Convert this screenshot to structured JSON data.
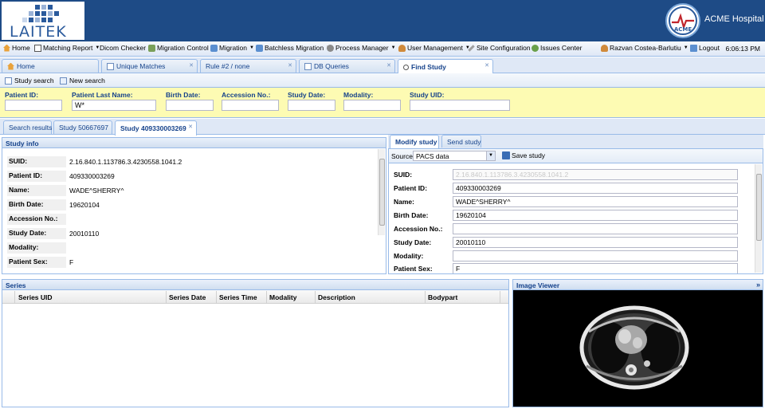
{
  "brand": {
    "logo_text": "LAITEK",
    "hospital_name": "ACME Hospital",
    "hospital_logo_text": "ACME"
  },
  "menu": {
    "items": [
      "Home",
      "Matching Report",
      "Dicom Checker",
      "Migration Control",
      "Migration",
      "Batchless Migration",
      "Process Manager",
      "User Management",
      "Site Configuration",
      "Issues Center"
    ],
    "user": "Razvan Costea-Barlutiu",
    "logout": "Logout",
    "clock": "6:06:13 PM"
  },
  "tabs": [
    "Home",
    "Unique Matches",
    "Rule #2 / none",
    "DB Queries",
    "Find Study"
  ],
  "toolbar": {
    "study_search": "Study search",
    "new_search": "New search"
  },
  "search": {
    "labels": [
      "Patient ID:",
      "Patient Last Name:",
      "Birth Date:",
      "Accession No.:",
      "Study Date:",
      "Modality:",
      "Study UID:"
    ],
    "values": [
      "",
      "W*",
      "",
      "",
      "",
      "",
      ""
    ]
  },
  "subtabs": [
    "Search results",
    "Study 50667697",
    "Study 409330003269"
  ],
  "study_info": {
    "title": "Study info",
    "rows": [
      {
        "k": "SUID:",
        "v": "2.16.840.1.113786.3.4230558.1041.2"
      },
      {
        "k": "Patient ID:",
        "v": "409330003269"
      },
      {
        "k": "Name:",
        "v": "WADE^SHERRY^"
      },
      {
        "k": "Birth Date:",
        "v": "19620104"
      },
      {
        "k": "Accession No.:",
        "v": ""
      },
      {
        "k": "Study Date:",
        "v": "20010110"
      },
      {
        "k": "Modality:",
        "v": ""
      },
      {
        "k": "Patient Sex:",
        "v": "F"
      }
    ]
  },
  "modify": {
    "tabs": [
      "Modify study",
      "Send study"
    ],
    "source_label": "Source:",
    "source_value": "PACS data",
    "save": "Save study",
    "rows": [
      {
        "k": "SUID:",
        "v": "2.16.840.1.113786.3.4230558.1041.2"
      },
      {
        "k": "Patient ID:",
        "v": "409330003269"
      },
      {
        "k": "Name:",
        "v": "WADE^SHERRY^"
      },
      {
        "k": "Birth Date:",
        "v": "19620104"
      },
      {
        "k": "Accession No.:",
        "v": ""
      },
      {
        "k": "Study Date:",
        "v": "20010110"
      },
      {
        "k": "Modality:",
        "v": ""
      },
      {
        "k": "Patient Sex:",
        "v": "F"
      }
    ]
  },
  "series": {
    "title": "Series",
    "columns": [
      "Series UID",
      "Series Date",
      "Series Time",
      "Modality",
      "Description",
      "Bodypart"
    ]
  },
  "viewer": {
    "title": "Image Viewer",
    "collapse": "»"
  }
}
